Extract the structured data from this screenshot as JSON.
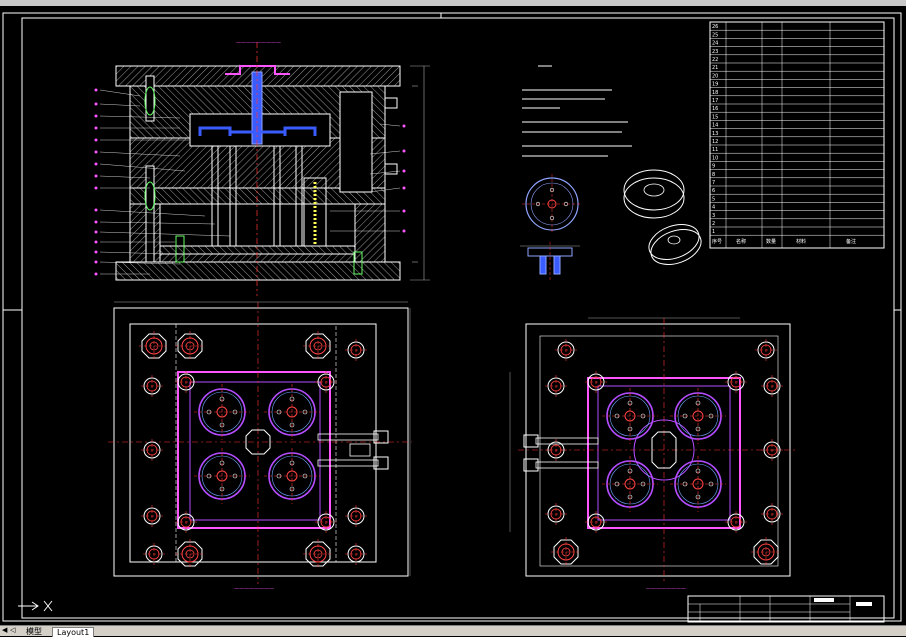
{
  "tabs": [
    {
      "label": "模型",
      "active": false
    },
    {
      "label": "Layout1",
      "active": true
    }
  ],
  "colors": {
    "background": "#000000",
    "outline": "#ffffff",
    "hatch": "#9a9a9a",
    "centerline": "#ff3333",
    "runner": "#3a5cff",
    "cavity": "#b44cff",
    "cooling": "#ff55ff",
    "dimension": "#aaaaaa",
    "label_magenta": "#ff55ff"
  },
  "bom": {
    "row_numbers": [
      "26",
      "25",
      "24",
      "23",
      "22",
      "21",
      "20",
      "19",
      "18",
      "17",
      "16",
      "15",
      "14",
      "13",
      "12",
      "11",
      "10",
      "9",
      "8",
      "7",
      "6",
      "5",
      "4",
      "3",
      "2",
      "1"
    ],
    "header": {
      "no": "序号",
      "name": "名称",
      "qty": "数量",
      "material": "材料",
      "remark": "备注"
    }
  },
  "icons": [
    "ucs-icon",
    "tab-first-icon",
    "tab-prev-icon",
    "tab-next-icon",
    "tab-last-icon"
  ]
}
